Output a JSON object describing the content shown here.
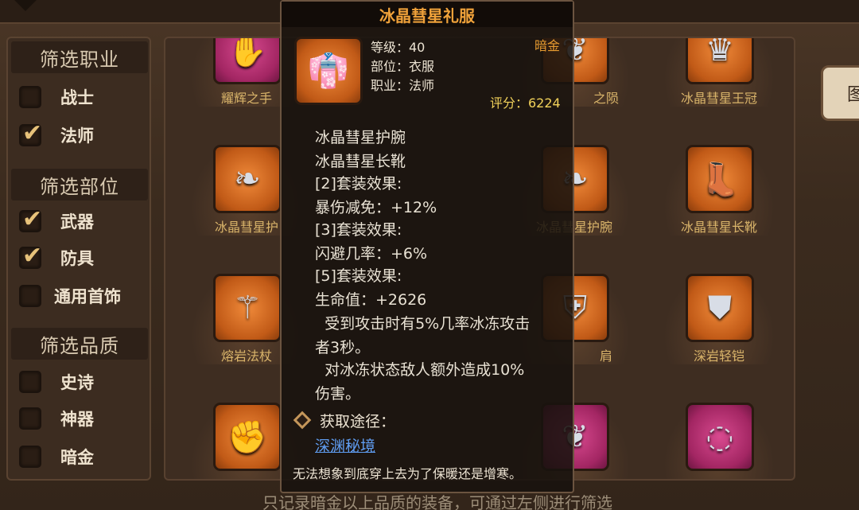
{
  "filter": {
    "class_header": "筛选职业",
    "classes": [
      {
        "label": "战士",
        "checked": false
      },
      {
        "label": "法师",
        "checked": true
      }
    ],
    "slot_header": "筛选部位",
    "slots": [
      {
        "label": "武器",
        "checked": true
      },
      {
        "label": "防具",
        "checked": true
      },
      {
        "label": "通用首饰",
        "checked": false
      }
    ],
    "quality_header": "筛选品质",
    "qualities": [
      {
        "label": "史诗",
        "checked": false
      },
      {
        "label": "神器",
        "checked": false
      },
      {
        "label": "暗金",
        "checked": false
      }
    ]
  },
  "grid": {
    "items": [
      {
        "name": "耀辉之手",
        "color": "pink",
        "icon": "glove-icon",
        "glyph": "✋"
      },
      {
        "name": "之陨",
        "color": "orange",
        "icon": "feather-icon",
        "glyph": "❦"
      },
      {
        "name": "冰晶彗星王冠",
        "color": "orange",
        "icon": "crown-icon",
        "glyph": "♛"
      },
      {
        "name": "冰晶彗星护",
        "color": "orange",
        "icon": "bracer-icon",
        "glyph": "❧"
      },
      {
        "name": "冰晶彗星护腕",
        "color": "orange",
        "icon": "bracer-icon",
        "glyph": "❧"
      },
      {
        "name": "冰晶彗星长靴",
        "color": "orange",
        "icon": "boots-icon",
        "glyph": "👢"
      },
      {
        "name": "熔岩法杖",
        "color": "orange",
        "icon": "staff-icon",
        "glyph": "⚚"
      },
      {
        "name": "肩",
        "color": "orange",
        "icon": "shoulder-icon",
        "glyph": "⛨"
      },
      {
        "name": "深岩轻铠",
        "color": "orange",
        "icon": "armor-icon",
        "glyph": "⛊"
      },
      {
        "name": "",
        "color": "orange",
        "icon": "gauntlet-icon",
        "glyph": "✊"
      },
      {
        "name": "",
        "color": "pink",
        "icon": "wing-icon",
        "glyph": "❦"
      },
      {
        "name": "",
        "color": "pink",
        "icon": "circlet-icon",
        "glyph": "◌"
      }
    ]
  },
  "side_tab": {
    "label": "图"
  },
  "bottom_hint": "只记录暗金以上品质的装备，可通过左侧进行筛选",
  "tooltip": {
    "title": "冰晶彗星礼服",
    "icon": "robe-icon",
    "icon_glyph": "👘",
    "level": "等级：40",
    "slot": "部位：衣服",
    "class": "职业：法师",
    "quality": "暗金",
    "score": "评分：6224",
    "description": [
      "冰晶彗星护腕",
      "冰晶彗星长靴",
      "[2]套装效果:",
      "暴伤减免：+12%",
      "[3]套装效果:",
      "闪避几率：+6%",
      "[5]套装效果:",
      "生命值：+2626",
      "  受到攻击时有5%几率冰冻攻击",
      "者3秒。",
      "  对冰冻状态敌人额外造成10%",
      "伤害。"
    ],
    "source_label": "获取途径：",
    "source_link": "深渊秘境",
    "flavor": "无法想象到底穿上去为了保暖还是增寒。"
  }
}
